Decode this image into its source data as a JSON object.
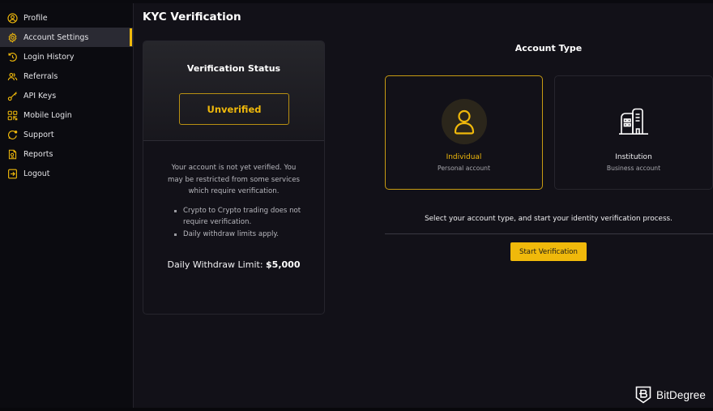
{
  "sidebar": {
    "items": [
      {
        "label": "Profile",
        "icon": "user-circle-icon",
        "active": false
      },
      {
        "label": "Account Settings",
        "icon": "gear-icon",
        "active": true
      },
      {
        "label": "Login History",
        "icon": "history-icon",
        "active": false
      },
      {
        "label": "Referrals",
        "icon": "users-icon",
        "active": false
      },
      {
        "label": "API Keys",
        "icon": "key-icon",
        "active": false
      },
      {
        "label": "Mobile Login",
        "icon": "qr-code-icon",
        "active": false
      },
      {
        "label": "Support",
        "icon": "support-chat-icon",
        "active": false
      },
      {
        "label": "Reports",
        "icon": "report-document-icon",
        "active": false
      },
      {
        "label": "Logout",
        "icon": "logout-icon",
        "active": false
      }
    ]
  },
  "page": {
    "title": "KYC Verification"
  },
  "verification_status": {
    "title": "Verification Status",
    "status": "Unverified",
    "description": "Your account is not yet verified. You may be restricted from some services which require verification.",
    "bullets": [
      "Crypto to Crypto trading does not require verification.",
      "Daily withdraw limits apply."
    ],
    "limit_label": "Daily Withdraw Limit:",
    "limit_value": "$5,000"
  },
  "account_type": {
    "title": "Account Type",
    "options": [
      {
        "name": "Individual",
        "subtitle": "Personal account",
        "icon": "user-icon",
        "selected": true
      },
      {
        "name": "Institution",
        "subtitle": "Business account",
        "icon": "building-icon",
        "selected": false
      }
    ],
    "instruction": "Select your account type, and start your identity verification process.",
    "start_button": "Start Verification"
  },
  "brand": {
    "name": "BitDegree",
    "icon": "bitdegree-shield-logo-icon"
  },
  "colors": {
    "accent": "#f0b90b",
    "background": "#121118",
    "sidebar": "#0b0b10",
    "active_item": "#2a2a33"
  }
}
